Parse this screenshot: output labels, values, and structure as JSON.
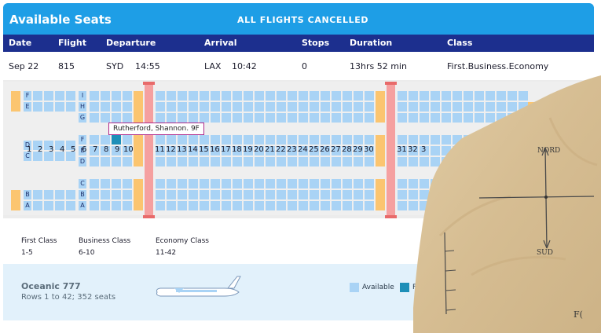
{
  "header": {
    "title": "Available Seats",
    "banner": "ALL FLIGHTS CANCELLED"
  },
  "columns": [
    "Date",
    "Flight",
    "Departure",
    "Arrival",
    "Stops",
    "Duration",
    "Class"
  ],
  "flight": {
    "date": "Sep 22",
    "number": "815",
    "dep_code": "SYD",
    "dep_time": "14:55",
    "arr_code": "LAX",
    "arr_time": "10:42",
    "stops": "0",
    "duration": "13hrs 52 min",
    "class": "First.Business.Economy"
  },
  "seat_letters": {
    "first_upper": [
      "F",
      "E"
    ],
    "first_middle": [
      "D",
      "C"
    ],
    "first_lower": [
      "B",
      "A"
    ],
    "business_upper": [
      "I",
      "H",
      "G"
    ],
    "business_middle": [
      "F",
      "E",
      "D"
    ],
    "business_lower": [
      "C",
      "B",
      "A"
    ]
  },
  "tooltip": "Rutherford, Shannon. 9F",
  "selected_seat": "9F",
  "row_numbers": [
    "1",
    "2",
    "3",
    "4",
    "5",
    "6",
    "7",
    "8",
    "9",
    "10",
    "11",
    "12",
    "13",
    "14",
    "15",
    "16",
    "17",
    "18",
    "19",
    "20",
    "21",
    "22",
    "23",
    "24",
    "25",
    "26",
    "27",
    "28",
    "29",
    "30",
    "31",
    "32",
    "3"
  ],
  "classes": [
    {
      "label": "First Class",
      "range": "1-5"
    },
    {
      "label": "Business Class",
      "range": "6-10"
    },
    {
      "label": "Economy Class",
      "range": "11-42"
    }
  ],
  "aircraft": {
    "name": "Oceanic 777",
    "summary": "Rows 1 to 42; 352 seats"
  },
  "legend": [
    {
      "label": "Available",
      "color": "#a9d3f5"
    },
    {
      "label": "F",
      "color": "#1e8fb8"
    }
  ],
  "paper_note": {
    "north": "NORD",
    "south": "SUD",
    "corner": "F("
  },
  "colors": {
    "accent": "#1e9ee6",
    "navy": "#1c2f8e",
    "seat": "#a9d3f5",
    "occupied": "#1e8fb8",
    "galley": "#fbc570",
    "exit": "#f5a0a0"
  }
}
